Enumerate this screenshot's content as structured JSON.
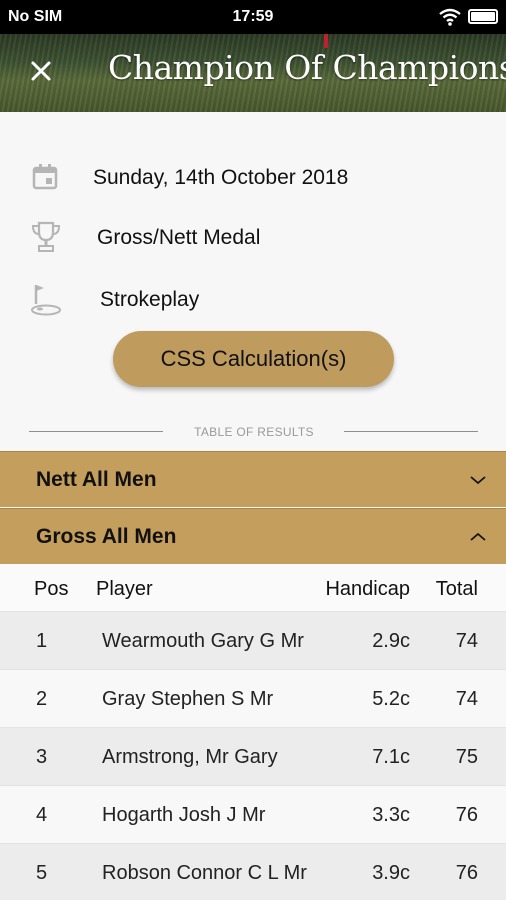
{
  "status_bar": {
    "carrier": "No SIM",
    "time": "17:59"
  },
  "header": {
    "title": "Champion Of Champions..."
  },
  "info": {
    "date": "Sunday, 14th October 2018",
    "format": "Gross/Nett Medal",
    "play_type": "Strokeplay"
  },
  "css_button": {
    "label": "CSS Calculation(s)"
  },
  "results": {
    "divider_label": "TABLE OF RESULTS",
    "sections": [
      {
        "label": "Nett All Men",
        "expanded": false
      },
      {
        "label": "Gross All Men",
        "expanded": true
      }
    ],
    "columns": {
      "pos": "Pos",
      "player": "Player",
      "handicap": "Handicap",
      "total": "Total"
    },
    "rows": [
      {
        "pos": "1",
        "player": "Wearmouth Gary G Mr",
        "handicap": "2.9c",
        "total": "74"
      },
      {
        "pos": "2",
        "player": "Gray Stephen S Mr",
        "handicap": "5.2c",
        "total": "74"
      },
      {
        "pos": "3",
        "player": "Armstrong, Mr Gary",
        "handicap": "7.1c",
        "total": "75"
      },
      {
        "pos": "4",
        "player": "Hogarth Josh J Mr",
        "handicap": "3.3c",
        "total": "76"
      },
      {
        "pos": "5",
        "player": "Robson Connor C L Mr",
        "handicap": "3.9c",
        "total": "76"
      }
    ]
  },
  "colors": {
    "accent": "#c49e5c",
    "button": "#bf9b5e"
  }
}
